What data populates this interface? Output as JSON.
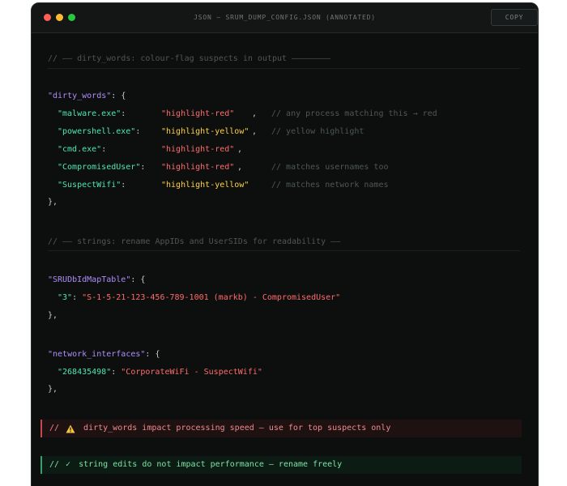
{
  "window": {
    "title": "JSON — SRUM_DUMP_CONFIG.JSON (ANNOTATED)",
    "copy_label": "COPY"
  },
  "sections": {
    "dirty_comment": "// —— dirty_words: colour-flag suspects in output ————————",
    "strings_comment": "// —— strings: rename AppIDs and UserSIDs for readability ——"
  },
  "dirty_words": {
    "key": "\"dirty_words\"",
    "open": ": {",
    "close": "},",
    "entries": [
      {
        "key": "\"malware.exe\"",
        "value": "\"highlight-red\"",
        "comment": "// any process matching this → red"
      },
      {
        "key": "\"powershell.exe\"",
        "value": "\"highlight-yellow\"",
        "comment": "// yellow highlight"
      },
      {
        "key": "\"cmd.exe\"",
        "value": "\"highlight-red\"",
        "comment": ""
      },
      {
        "key": "\"CompromisedUser\"",
        "value": "\"highlight-red\"",
        "comment": "// matches usernames too"
      },
      {
        "key": "\"SuspectWifi\"",
        "value": "\"highlight-yellow\"",
        "comment": "// matches network names"
      }
    ]
  },
  "srud_map": {
    "key": "\"SRUDbIdMapTable\"",
    "open": ": {",
    "close": "},",
    "entry_key": "\"3\"",
    "entry_value": "\"S-1-5-21-123-456-789-1001 (markb) - CompromisedUser\""
  },
  "network_interfaces": {
    "key": "\"network_interfaces\"",
    "open": ": {",
    "close": "},",
    "entry_key": "\"268435498\"",
    "entry_value": "\"CorporateWiFi - SuspectWifi\""
  },
  "notes": {
    "warning": {
      "prefix": "//",
      "text": "dirty_words impact processing speed — use for top suspects only"
    },
    "ok": {
      "prefix": "//",
      "symbol": "✓",
      "text": "string edits do not impact performance — rename freely"
    }
  },
  "colors": {
    "background": "#0d0f0f",
    "key": "#4ce8b0",
    "section_key": "#b08cf8",
    "string_red": "#ff6b6b",
    "string_yellow": "#ffd23f",
    "comment": "#4e5656"
  }
}
